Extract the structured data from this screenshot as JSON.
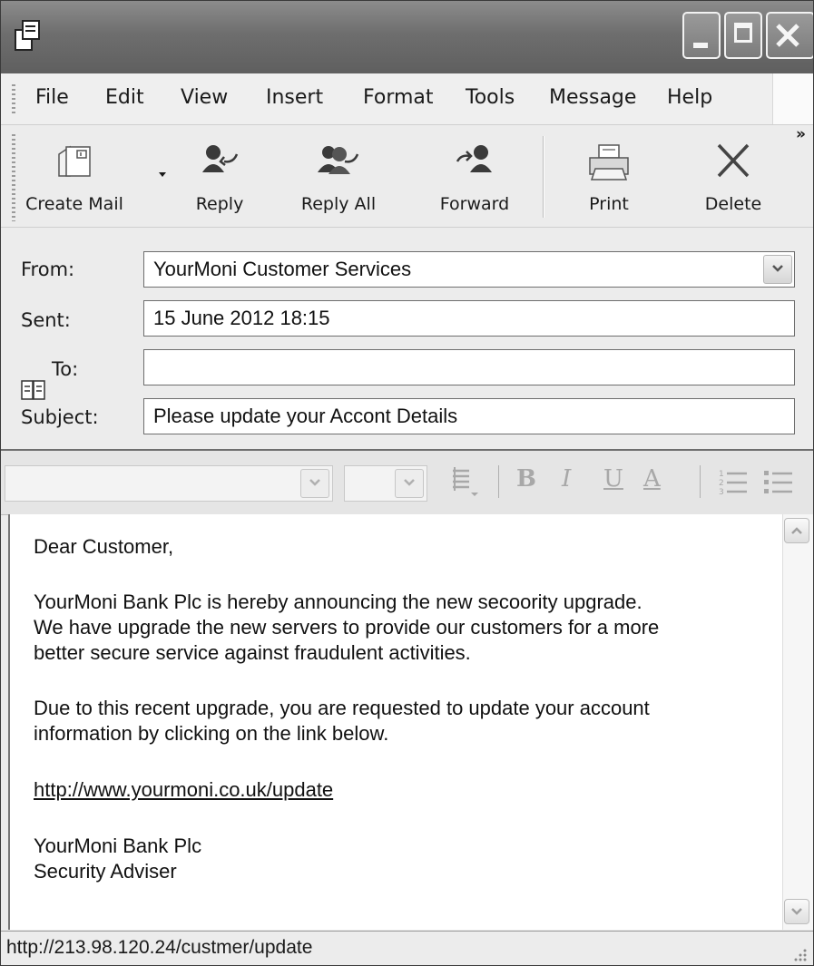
{
  "menu": [
    "File",
    "Edit",
    "View",
    "Insert",
    "Format",
    "Tools",
    "Message",
    "Help"
  ],
  "toolbar": {
    "create_mail": "Create Mail",
    "reply": "Reply",
    "reply_all": "Reply All",
    "forward": "Forward",
    "print": "Print",
    "delete": "Delete",
    "overflow": "»"
  },
  "header": {
    "from_label": "From:",
    "from_value": "YourMoni Customer Services",
    "sent_label": "Sent:",
    "sent_value": "15 June 2012 18:15",
    "to_label": "To:",
    "to_value": "",
    "subject_label": "Subject:",
    "subject_value": "Please update your Accont Details"
  },
  "formatting": {
    "bold": "B",
    "italic": "I",
    "underline": "U",
    "font_color": "A"
  },
  "body": {
    "greeting": "Dear Customer,",
    "paragraph1": [
      "YourMoni Bank Plc is hereby announcing the new secoority upgrade.",
      "We have upgrade the new servers to provide our customers for a more",
      "better secure service against fraudulent activities."
    ],
    "paragraph2": [
      "Due to this recent upgrade, you are requested to update your account",
      "information by clicking on the link below."
    ],
    "link": "http://www.yourmoni.co.uk/update",
    "signature": [
      "YourMoni Bank Plc",
      "Security Adviser"
    ]
  },
  "status_bar": "http://213.98.120.24/custmer/update"
}
